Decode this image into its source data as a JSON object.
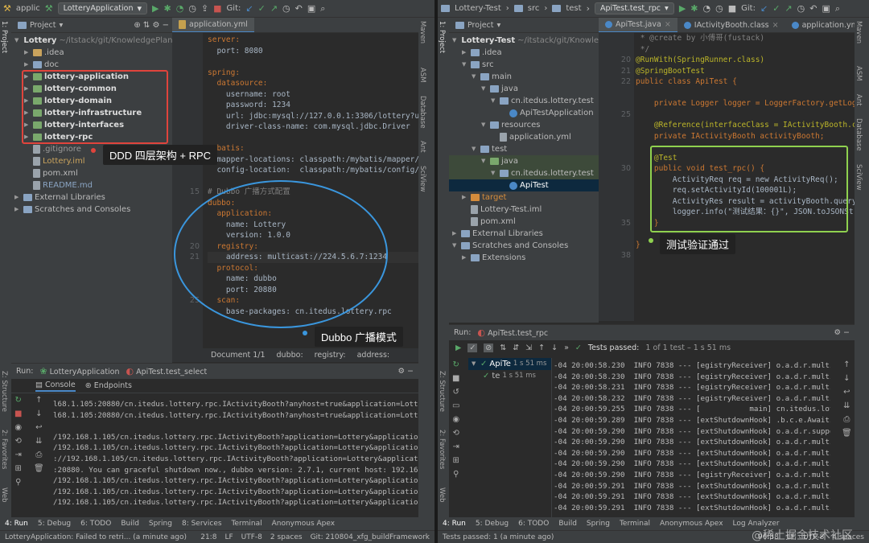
{
  "left": {
    "toolbar": {
      "app": "applic",
      "run_config": "LotteryApplication",
      "git_label": "Git:"
    },
    "project_header": "Project",
    "editor_tab": "application.yml",
    "tree": [
      {
        "label": "Lottery",
        "sub": "~/itstack/git/KnowledgePlan",
        "bold": true
      },
      {
        "label": ".idea"
      },
      {
        "label": "doc"
      },
      {
        "label": "lottery-application",
        "bold": true
      },
      {
        "label": "lottery-common",
        "bold": true
      },
      {
        "label": "lottery-domain",
        "bold": true
      },
      {
        "label": "lottery-infrastructure",
        "bold": true
      },
      {
        "label": "lottery-interfaces",
        "bold": true
      },
      {
        "label": "lottery-rpc",
        "bold": true
      },
      {
        "label": ".gitignore"
      },
      {
        "label": "Lottery.iml"
      },
      {
        "label": "pom.xml"
      },
      {
        "label": "README.md"
      },
      {
        "label": "External Libraries"
      },
      {
        "label": "Scratches and Consoles"
      }
    ],
    "code": [
      "server:",
      "  port: 8080",
      "",
      "spring:",
      "  datasource:",
      "    username: root",
      "    password: 1234",
      "    url: jdbc:mysql://127.0.0.1:3306/lottery?useUn",
      "    driver-class-name: com.mysql.jdbc.Driver",
      "",
      "mybatis:",
      "  mapper-locations: classpath:/mybatis/mapper/*.xm",
      "  config-location:  classpath:/mybatis/config/myba",
      "",
      "# Dubbo 广播方式配置",
      "dubbo:",
      "  application:",
      "    name: Lottery",
      "    version: 1.0.0",
      "  registry:",
      "    address: multicast://224.5.6.7:1234",
      "  protocol:",
      "    name: dubbo",
      "    port: 20880",
      "  scan:",
      "    base-packages: cn.itedus.lottery.rpc"
    ],
    "gutter": [
      "",
      "",
      "",
      "",
      "",
      "",
      "",
      "",
      "",
      "",
      "",
      "",
      "",
      "",
      "15",
      "",
      "",
      "",
      "",
      "20",
      "21",
      "",
      "",
      "",
      "25",
      ""
    ],
    "breadcrumb": [
      "Document 1/1",
      "dubbo:",
      "registry:",
      "address:"
    ],
    "run_header": {
      "label": "Run:",
      "tab1": "LotteryApplication",
      "tab2": "ApiTest.test_select"
    },
    "run_subtabs": [
      "Console",
      "Endpoints"
    ],
    "log": [
      "l68.1.105:20880/cn.itedus.lottery.rpc.IActivityBooth?anyhost=true&application=Lottery&a",
      "l68.1.105:20880/cn.itedus.lottery.rpc.IActivityBooth?anyhost=true&application=Lottery&a",
      "",
      "/192.168.1.105/cn.itedus.lottery.rpc.IActivityBooth?application=Lottery&application.ver",
      "/192.168.1.105/cn.itedus.lottery.rpc.IActivityBooth?application=Lottery&application.ver",
      "://192.168.1.105/cn.itedus.lottery.rpc.IActivityBooth?application=Lottery&application.ver",
      ":20880. You can graceful shutdown now., dubbo version: 2.7.1, current host: 192.168.1.1",
      "/192.168.1.105/cn.itedus.lottery.rpc.IActivityBooth?application=Lottery&application.ver",
      "/192.168.1.105/cn.itedus.lottery.rpc.IActivityBooth?application=Lottery&application.ver",
      "/192.168.1.105/cn.itedus.lottery.rpc.IActivityBooth?application=Lottery&application.ver"
    ],
    "bottom_tabs": [
      "4: Run",
      "5: Debug",
      "6: TODO",
      "Build",
      "Spring",
      "8: Services",
      "Terminal",
      "Anonymous Apex"
    ],
    "status": [
      "LotteryApplication: Failed to retri... (a minute ago)",
      "21:8",
      "LF",
      "UTF-8",
      "2 spaces",
      "Git: 210804_xfg_buildFramework"
    ],
    "side_labels": {
      "project": "1: Project",
      "structure": "Z: Structure",
      "favorites": "2: Favorites",
      "web": "Web",
      "maven": "Maven",
      "asm": "ASM",
      "database": "Database",
      "ant": "Ant",
      "sciview": "SciView"
    }
  },
  "right": {
    "toolbar": {
      "project": "Lottery-Test",
      "crumb1": "src",
      "crumb2": "test",
      "run_config": "ApiTest.test_rpc",
      "git_label": "Git:"
    },
    "project_header": "Project",
    "editor_tabs": [
      "ApiTest.java",
      "IActivityBooth.class",
      "application.ym"
    ],
    "tree": [
      {
        "label": "Lottery-Test",
        "sub": "~/itstack/git/Knowle",
        "bold": true
      },
      {
        "label": ".idea"
      },
      {
        "label": "src"
      },
      {
        "label": "main"
      },
      {
        "label": "java"
      },
      {
        "label": "cn.itedus.lottery.test"
      },
      {
        "label": "ApiTestApplication"
      },
      {
        "label": "resources"
      },
      {
        "label": "application.yml"
      },
      {
        "label": "test"
      },
      {
        "label": "java"
      },
      {
        "label": "cn.itedus.lottery.test"
      },
      {
        "label": "ApiTest"
      },
      {
        "label": "target"
      },
      {
        "label": "Lottery-Test.iml"
      },
      {
        "label": "pom.xml"
      },
      {
        "label": "External Libraries"
      },
      {
        "label": "Scratches and Consoles"
      },
      {
        "label": "Extensions"
      }
    ],
    "gutter": [
      "",
      "",
      "20",
      "21",
      "22",
      "",
      "",
      "25",
      "",
      "",
      "",
      "",
      "30",
      "",
      "",
      "",
      "",
      "35",
      "",
      "",
      "38"
    ],
    "code": [
      " * @create by 小傅哥(fustack)",
      " */",
      "@RunWith(SpringRunner.class)",
      "@SpringBootTest",
      "public class ApiTest {",
      "",
      "    private Logger logger = LoggerFactory.getLogger(",
      "",
      "    @Reference(interfaceClass = IActivityBooth.class",
      "    private IActivityBooth activityBooth;",
      "",
      "    @Test",
      "    public void test_rpc() {",
      "        ActivityReq req = new ActivityReq();",
      "        req.setActivityId(100001L);",
      "        ActivityRes result = activityBooth.queryActi",
      "        logger.info(\"测试结果：{}\", JSON.toJSONString",
      "    }",
      "",
      "}",
      ""
    ],
    "run_header": {
      "label": "Run:",
      "tab": "ApiTest.test_rpc"
    },
    "tests_passed": {
      "label": "Tests passed:",
      "detail": "1 of 1 test – 1 s 51 ms"
    },
    "test_tree": [
      {
        "label": "ApiTe",
        "time": "1 s 51 ms"
      },
      {
        "label": "te",
        "time": "1 s 51 ms"
      }
    ],
    "log": [
      "-04 20:00:58.230  INFO 7838 --- [egistryReceiver] o.a.d.r.multicast.",
      "-04 20:00:58.230  INFO 7838 --- [egistryReceiver] o.a.d.r.multicast.",
      "-04 20:00:58.231  INFO 7838 --- [egistryReceiver] o.a.d.r.multicast.",
      "-04 20:00:58.232  INFO 7838 --- [egistryReceiver] o.a.d.r.multicast.",
      "-04 20:00:59.255  INFO 7838 --- [           main] cn.itedus.lottery.",
      "-04 20:00:59.289  INFO 7838 --- [extShutdownHook] .b.c.e.AwaitingNor",
      "-04 20:00:59.290  INFO 7838 --- [extShutdownHook] o.a.d.r.support.Ab",
      "-04 20:00:59.290  INFO 7838 --- [extShutdownHook] o.a.d.r.multicast.",
      "-04 20:00:59.290  INFO 7838 --- [extShutdownHook] o.a.d.r.multicast.",
      "-04 20:00:59.290  INFO 7838 --- [extShutdownHook] o.a.d.r.multicast.",
      "-04 20:00:59.290  INFO 7838 --- [egistryReceiver] o.a.d.r.multicast.",
      "-04 20:00:59.291  INFO 7838 --- [extShutdownHook] o.a.d.r.multicast.",
      "-04 20:00:59.291  INFO 7838 --- [extShutdownHook] o.a.d.r.multicast.",
      "-04 20:00:59.291  INFO 7838 --- [extShutdownHook] o.a.d.r.multicast."
    ],
    "bottom_tabs": [
      "4: Run",
      "5: Debug",
      "6: TODO",
      "Build",
      "Spring",
      "Terminal",
      "Anonymous Apex",
      "Log Analyzer"
    ],
    "status": [
      "Tests passed: 1 (a minute ago)",
      "96:38",
      "LF",
      "UTF-8",
      "4 spaces"
    ],
    "side_labels": {
      "project": "1: Project",
      "structure": "Z: Structure",
      "favorites": "2: Favorites",
      "web": "Web",
      "maven": "Maven",
      "asm": "ASM",
      "ant": "Ant",
      "database": "Database",
      "sciview": "SciView"
    }
  },
  "annotations": {
    "ddd": "DDD 四层架构 + RPC",
    "dubbo": "Dubbo 广播模式",
    "verified": "测试验证通过",
    "watermark": "@稀土掘金技术社区"
  },
  "colors": {
    "red_box": "#e0443c",
    "blue_ellipse": "#3a96dd",
    "green_box": "#8fd14f",
    "accent": "#4a88c7"
  }
}
